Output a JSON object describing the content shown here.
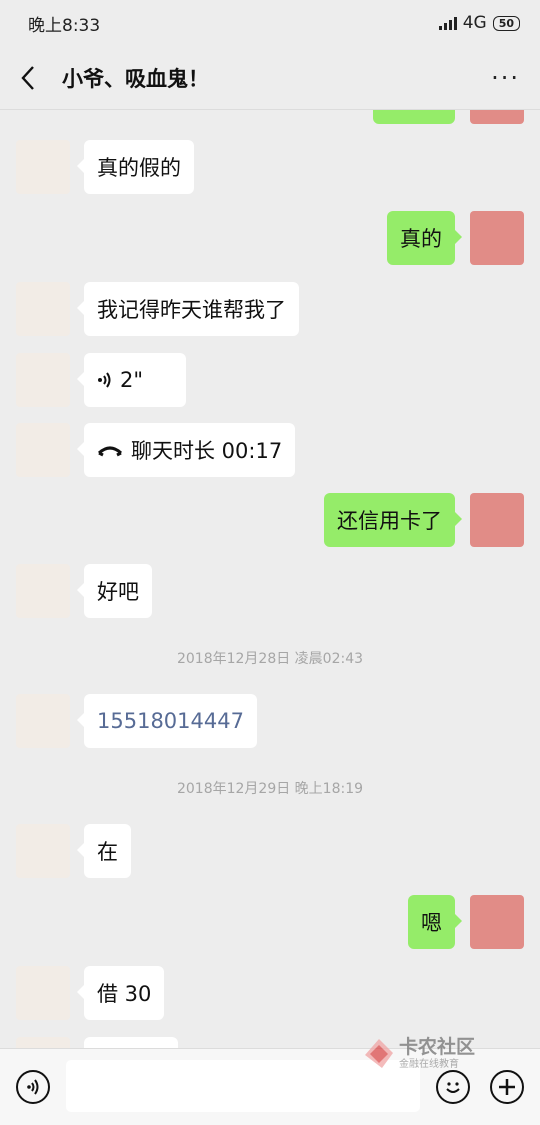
{
  "status": {
    "time": "晚上8:33",
    "network": "4G",
    "battery": "50"
  },
  "header": {
    "title": "小爷、吸血鬼！",
    "more_label": "···"
  },
  "messages": {
    "m1": "真的假的",
    "m2": "真的",
    "m3": "我记得昨天谁帮我了",
    "m4": "2\"",
    "m5": "聊天时长 00:17",
    "m6": "还信用卡了",
    "m7": "好吧",
    "t1": "2018年12月28日 凌晨02:43",
    "m8": "15518014447",
    "t2": "2018年12月29日 晚上18:19",
    "m9": "在",
    "m10": "嗯",
    "m11": "借 30"
  },
  "watermark": {
    "main": "卡农社区",
    "sub": "金融在线教育"
  },
  "icons": [
    "voice-icon",
    "emoji-icon",
    "plus-icon",
    "back-icon",
    "phone-icon"
  ]
}
